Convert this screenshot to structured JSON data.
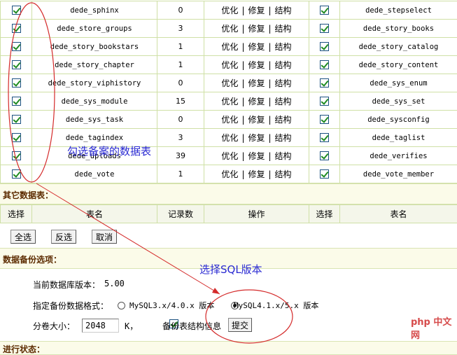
{
  "tables": [
    {
      "left": "dede_sphinx",
      "count": "0",
      "right": "dede_stepselect"
    },
    {
      "left": "dede_store_groups",
      "count": "3",
      "right": "dede_story_books"
    },
    {
      "left": "dede_story_bookstars",
      "count": "1",
      "right": "dede_story_catalog"
    },
    {
      "left": "dede_story_chapter",
      "count": "1",
      "right": "dede_story_content"
    },
    {
      "left": "dede_story_viphistory",
      "count": "0",
      "right": "dede_sys_enum"
    },
    {
      "left": "dede_sys_module",
      "count": "15",
      "right": "dede_sys_set"
    },
    {
      "left": "dede_sys_task",
      "count": "0",
      "right": "dede_sysconfig"
    },
    {
      "left": "dede_tagindex",
      "count": "3",
      "right": "dede_taglist"
    },
    {
      "left": "dede_uploads",
      "count": "39",
      "right": "dede_verifies"
    },
    {
      "left": "dede_vote",
      "count": "1",
      "right": "dede_vote_member"
    }
  ],
  "ops": {
    "optimize": "优化",
    "repair": "修复",
    "structure": "结构",
    "sep": "|"
  },
  "other_tables": {
    "title": "其它数据表：",
    "headers": [
      "选择",
      "表名",
      "记录数",
      "操作",
      "选择",
      "表名"
    ]
  },
  "buttons": {
    "select_all": "全选",
    "invert": "反选",
    "cancel": "取消",
    "submit": "提交"
  },
  "backup": {
    "title": "数据备份选项：",
    "db_version_label": "当前数据库版本：",
    "db_version": "5.00",
    "format_label": "指定备份数据格式：",
    "format_opt1": "MySQL3.x/4.0.x 版本",
    "format_opt2": "MySQL4.1.x/5.x 版本",
    "volume_label": "分卷大小：",
    "volume_value": "2048",
    "volume_unit": "K，",
    "structure_label": "备份表结构信息"
  },
  "progress": {
    "title": "进行状态："
  },
  "annotations": {
    "tables": "勾选备案的数据表",
    "sql": "选择SQL版本"
  },
  "watermark": "php 中文网",
  "colors": {
    "annotation": "#2a2ad2",
    "circle": "#d42a2a",
    "section_title": "#5c2b00",
    "border": "#cfe0a6"
  }
}
